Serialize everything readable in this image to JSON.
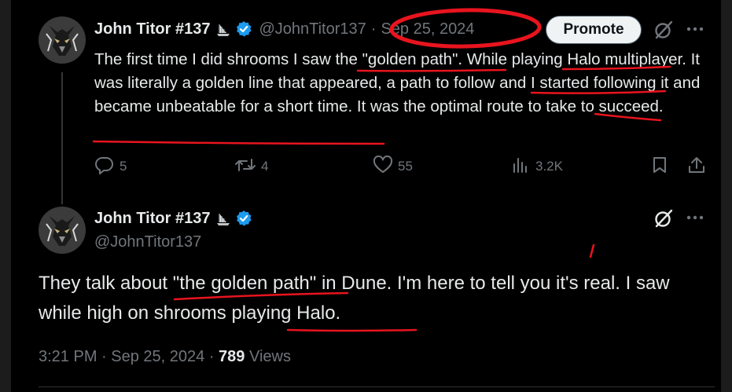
{
  "colors": {
    "background": "#000000",
    "text_primary": "#e7e9ea",
    "text_secondary": "#71767b",
    "verified_blue": "#1d9bf0",
    "annotation_red": "#e8141e"
  },
  "first_tweet": {
    "display_name": "John Titor #137",
    "name_badge_icon": "ship-emoji-icon",
    "verified_icon": "verified-badge-icon",
    "handle": "@JohnTitor137",
    "separator": "·",
    "date": "Sep 25, 2024",
    "promote_label": "Promote",
    "grok_icon": "grok-icon",
    "more_icon": "more-icon",
    "text": "The first time I did shrooms I saw the \"golden path\". While playing Halo multiplayer. It was literally a golden line that appeared, a path to follow and I started following it and became unbeatable for a short time. It was the optimal route to take to succeed.",
    "actions": {
      "replies": "5",
      "reposts": "4",
      "likes": "55",
      "views": "3.2K"
    }
  },
  "main_tweet": {
    "display_name": "John Titor #137",
    "handle": "@JohnTitor137",
    "text": "They talk about \"the golden path\" in Dune. I'm here to tell you it's real. I saw while high on shrooms playing Halo.",
    "time": "3:21 PM",
    "separator": "·",
    "date": "Sep 25, 2024",
    "views_count": "789",
    "views_label": "Views"
  }
}
